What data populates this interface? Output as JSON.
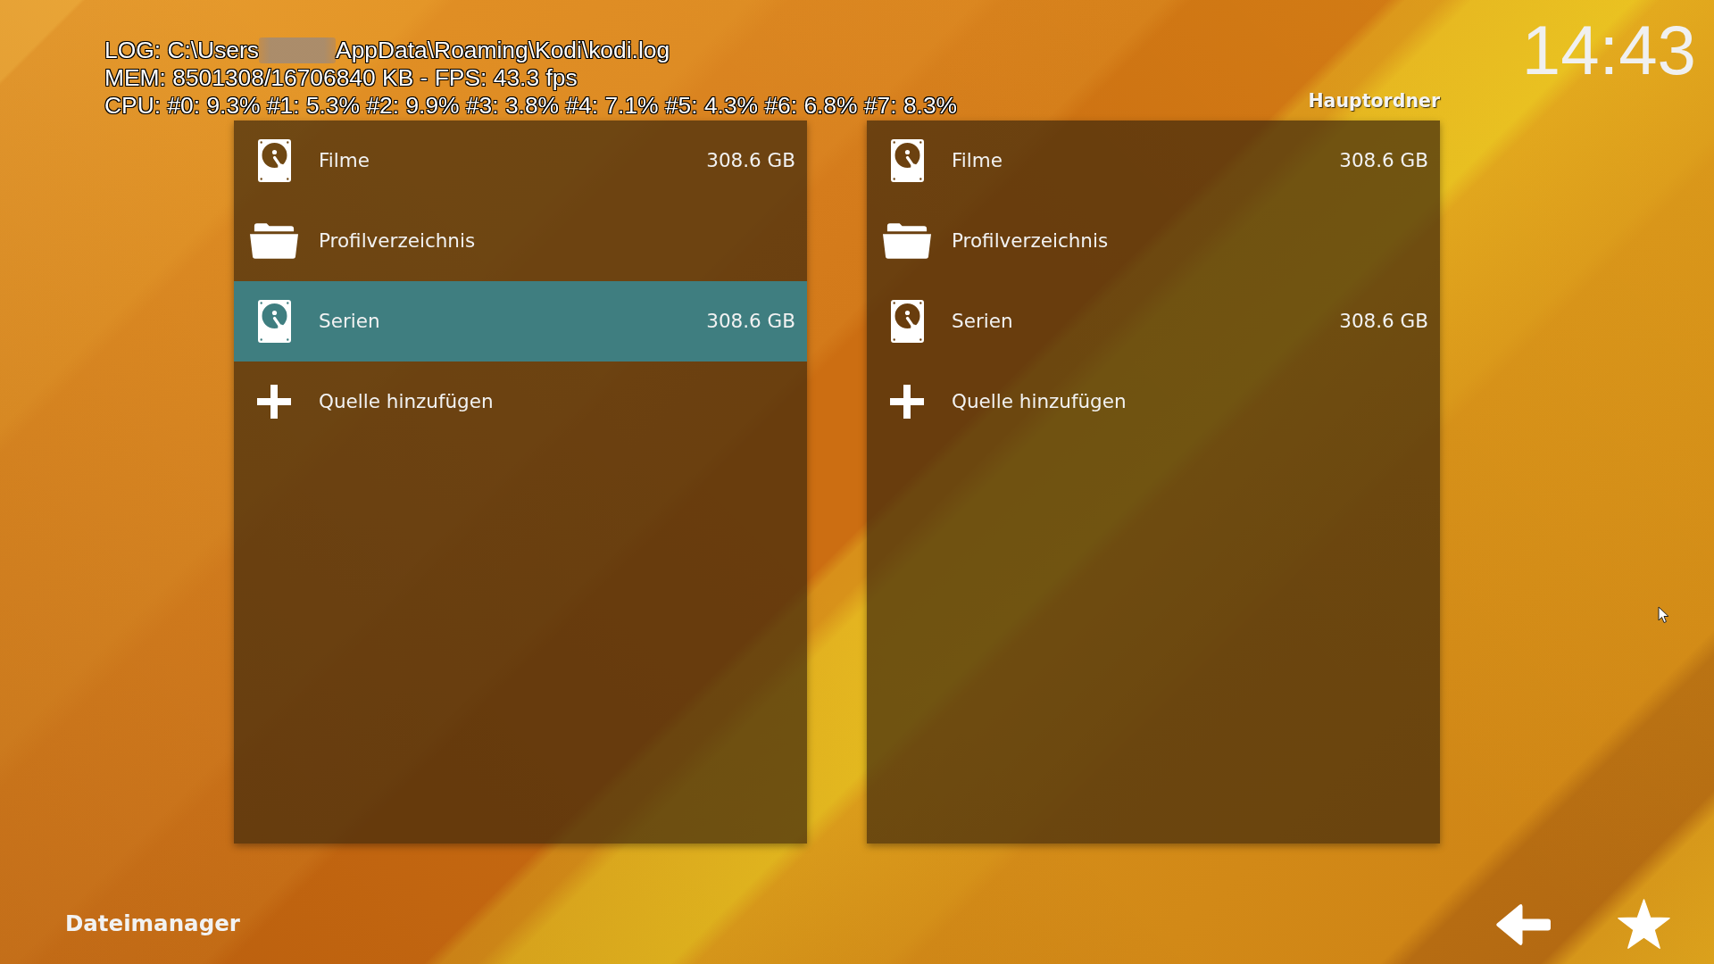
{
  "debug_overlay": {
    "log": [
      "LOG: C:\\Users",
      "AppData\\Roaming\\Kodi\\kodi.log"
    ],
    "memory": "MEM: 8501308/16706840 KB - FPS: 43.3 fps",
    "cpu": "CPU: #0: 9.3% #1: 5.3% #2: 9.9% #3: 3.8% #4: 7.1% #5: 4.3% #6: 6.8% #7: 8.3%"
  },
  "clock": "14:43",
  "panels": [
    {
      "items": [
        {
          "kind": "drive",
          "name": "Filme",
          "size": "308.6 GB",
          "selected": false
        },
        {
          "kind": "folder",
          "name": "Profilverzeichnis",
          "selected": false
        },
        {
          "kind": "drive",
          "name": "Serien",
          "size": "308.6 GB",
          "selected": true
        },
        {
          "kind": "add",
          "name": "Quelle hinzufügen",
          "selected": false
        }
      ]
    },
    {
      "path_label": "Hauptordner",
      "items": [
        {
          "kind": "drive",
          "name": "Filme",
          "size": "308.6 GB",
          "selected": false
        },
        {
          "kind": "folder",
          "name": "Profilverzeichnis",
          "selected": false
        },
        {
          "kind": "drive",
          "name": "Serien",
          "size": "308.6 GB",
          "selected": false
        },
        {
          "kind": "add",
          "name": "Quelle hinzufügen",
          "selected": false
        }
      ]
    }
  ],
  "footer": {
    "title": "Dateimanager"
  }
}
